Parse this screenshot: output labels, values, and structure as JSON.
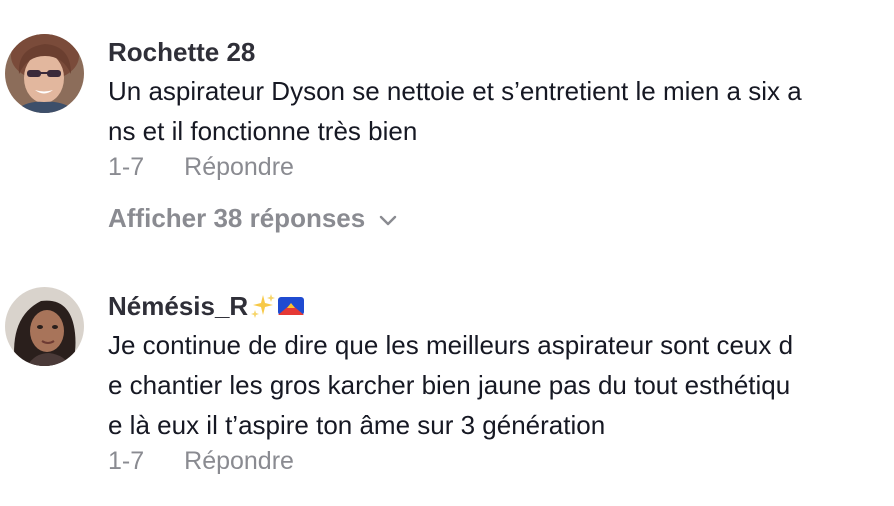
{
  "comments": [
    {
      "author": "Rochette 28",
      "text_lines": [
        "Un aspirateur Dyson se nettoie et s’entretient le mien a six a",
        "ns et il fonctionne très bien"
      ],
      "date": "1-7",
      "reply_label": "Répondre",
      "view_replies_label": "Afficher 38 réponses"
    },
    {
      "author": "Némésis_R",
      "author_emojis": [
        "sparkles-icon",
        "flag-icon"
      ],
      "text_lines": [
        "Je continue de dire que les meilleurs aspirateur sont ceux d",
        "e chantier les gros karcher bien jaune pas du tout esthétiqu",
        "e là eux il t’aspire ton âme sur 3 génération"
      ],
      "date": "1-7",
      "reply_label": "Répondre"
    }
  ],
  "colors": {
    "text": "#161823",
    "author": "#2f2f38",
    "muted": "#8a8b91"
  }
}
